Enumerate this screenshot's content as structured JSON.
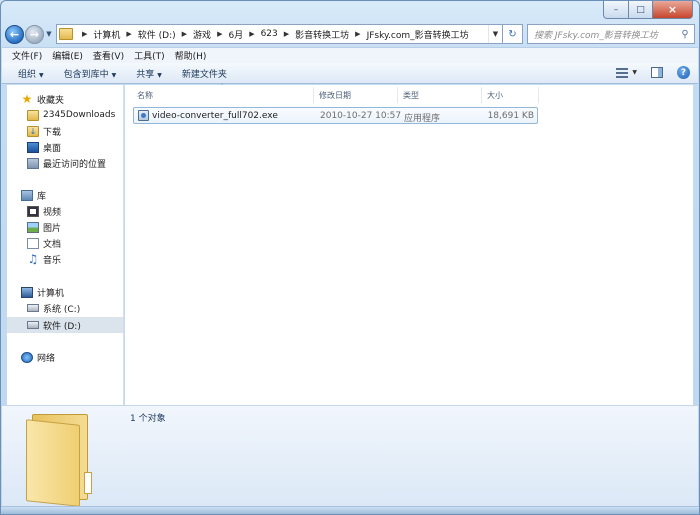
{
  "breadcrumbs": [
    "计算机",
    "软件 (D:)",
    "游戏",
    "6月",
    "623",
    "影音转换工坊",
    "JFsky.com_影音转换工坊"
  ],
  "search": {
    "placeholder": "搜索 JFsky.com_影音转换工坊"
  },
  "menu": [
    "文件(F)",
    "编辑(E)",
    "查看(V)",
    "工具(T)",
    "帮助(H)"
  ],
  "toolbar": {
    "organize": "组织",
    "include_library": "包含到库中",
    "share": "共享",
    "new_folder": "新建文件夹"
  },
  "nav": {
    "favorites": "收藏夹",
    "downloads_2345": "2345Downloads",
    "downloads": "下载",
    "desktop": "桌面",
    "recent": "最近访问的位置",
    "libraries": "库",
    "videos": "视频",
    "pictures": "图片",
    "documents": "文档",
    "music": "音乐",
    "computer": "计算机",
    "drive_c": "系统 (C:)",
    "drive_d": "软件 (D:)",
    "network": "网络"
  },
  "columns": {
    "name": "名称",
    "date": "修改日期",
    "type": "类型",
    "size": "大小"
  },
  "files": [
    {
      "name": "video-converter_full702.exe",
      "date": "2010-10-27 10:57",
      "type": "应用程序",
      "size": "18,691 KB"
    }
  ],
  "details": {
    "count": "1 个对象"
  },
  "colors": {
    "accent": "#3a6db0",
    "selection": "#dbe3ec",
    "window_frame": "#c4dcf2"
  },
  "icons": {
    "back": "back-arrow-icon",
    "forward": "forward-arrow-icon",
    "refresh": "refresh-icon",
    "search": "search-icon",
    "help": "help-icon"
  }
}
